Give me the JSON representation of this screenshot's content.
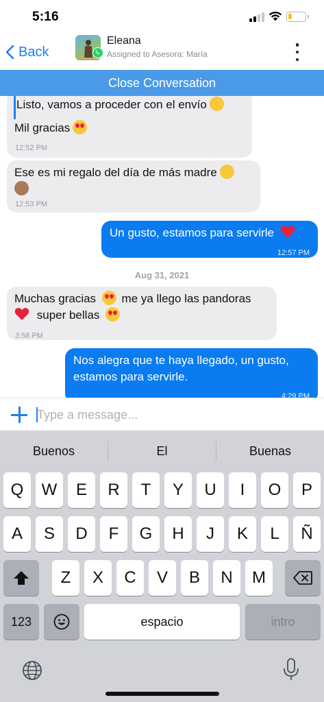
{
  "status_bar": {
    "time": "5:16"
  },
  "header": {
    "back_label": "Back",
    "contact_name": "Eleana",
    "assigned_text": "Assigned to Asesora: María",
    "close_label": "Close Conversation"
  },
  "messages": [
    {
      "direction": "in",
      "text_1": "Listo, vamos a proceder con el envío",
      "text_2": "Mil gracias",
      "time": "12:52 PM"
    },
    {
      "direction": "in",
      "text": "Ese es mi regalo del día de más madre",
      "time": "12:53 PM"
    },
    {
      "direction": "out",
      "text": "Un gusto, estamos para servirle",
      "time": "12:57 PM"
    },
    {
      "direction": "in",
      "text_1": "Muchas gracias",
      "text_2": "me ya llego las pandoras",
      "text_3": "super bellas",
      "time": "3:58 PM"
    },
    {
      "direction": "out",
      "text_1": "Nos alegra que te haya llegado, un gusto,",
      "text_2": "estamos para servirle.",
      "time": "4:29 PM"
    }
  ],
  "date_separator": "Aug 31, 2021",
  "composer": {
    "placeholder": "Type a message..."
  },
  "keyboard": {
    "suggestions": [
      "Buenos",
      "El",
      "Buenas"
    ],
    "row1": [
      "Q",
      "W",
      "E",
      "R",
      "T",
      "Y",
      "U",
      "I",
      "O",
      "P"
    ],
    "row2": [
      "A",
      "S",
      "D",
      "F",
      "G",
      "H",
      "J",
      "K",
      "L",
      "Ñ"
    ],
    "row3": [
      "Z",
      "X",
      "C",
      "V",
      "B",
      "N",
      "M"
    ],
    "numbers_label": "123",
    "space_label": "espacio",
    "return_label": "intro"
  },
  "icons": [
    "back-chevron-icon",
    "whatsapp-icon",
    "more-vertical-icon",
    "plus-icon",
    "shift-icon",
    "backspace-icon",
    "emoji-icon",
    "globe-icon",
    "microphone-icon"
  ],
  "colors": {
    "accent": "#1f7ef5",
    "close_bar": "#4a9ae8",
    "outgoing_bubble": "#0a7cf0",
    "incoming_bubble": "#ececef",
    "keyboard_bg": "#d1d3d9"
  }
}
